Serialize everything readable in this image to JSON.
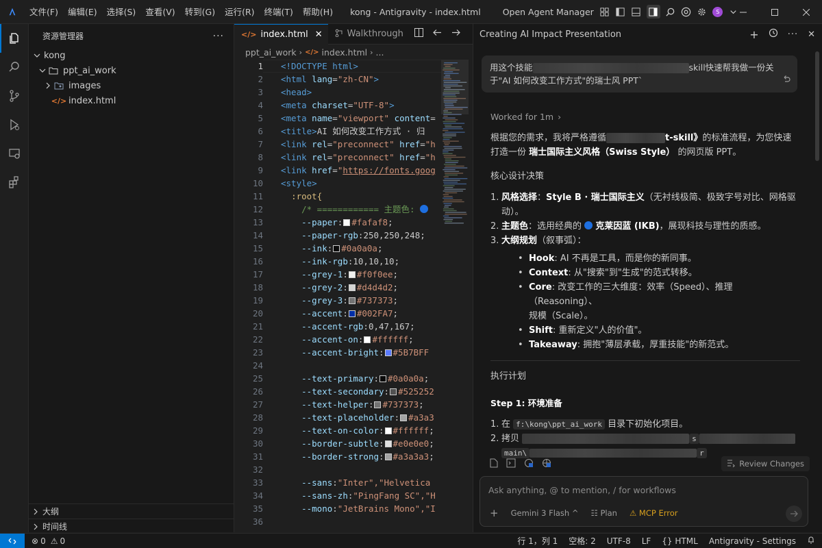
{
  "titlebar": {
    "menus": [
      "文件(F)",
      "编辑(E)",
      "选择(S)",
      "查看(V)",
      "转到(G)",
      "运行(R)",
      "终端(T)",
      "帮助(H)"
    ],
    "window_title": "kong - Antigravity - index.html",
    "agent_manager": "Open Agent Manager",
    "avatar_letter": "S"
  },
  "sidebar": {
    "title": "资源管理器",
    "root": "kong",
    "folder": "ppt_ai_work",
    "subfolder": "images",
    "file": "index.html",
    "outline": "大纲",
    "timeline": "时间线"
  },
  "editor": {
    "tab_active": "index.html",
    "tab_inactive": "Walkthrough",
    "breadcrumb_folder": "ppt_ai_work",
    "breadcrumb_file": "index.html",
    "breadcrumb_more": "..."
  },
  "code": {
    "l1": "<!DOCTYPE html>",
    "l2a": "<html",
    "l2b": " lang",
    "l2c": "=",
    "l2d": "\"zh-CN\"",
    "l2e": ">",
    "l3": "<head>",
    "l4a": "<meta",
    "l4b": " charset",
    "l4d": "\"UTF-8\"",
    "l4e": ">",
    "l5a": "<meta",
    "l5b": " name",
    "l5d": "\"viewport\"",
    "l5f": " content",
    "l6a": "<title>",
    "l6b": "AI 如何改变工作方式 · 归",
    "l7a": "<link",
    "l7b": " rel",
    "l7d": "\"preconnect\"",
    "l7f": " href",
    "l7g": "\"h",
    "l8a": "<link",
    "l8b": " rel",
    "l8d": "\"preconnect\"",
    "l8f": " href",
    "l8g": "\"h",
    "l9a": "<link",
    "l9b": " href",
    "l9d": "\"",
    "l9url": "https://fonts.goog",
    "l10": "<style>",
    "l11": ":root{",
    "l12": "/* ============ 主题色: ",
    "l13a": "--paper",
    "l13b": "#fafaf8",
    "l13c": ";",
    "l14a": "--paper-rgb",
    "l14b": "250,250,248",
    "l14c": ";",
    "l15a": "--ink",
    "l15b": "#0a0a0a",
    "l15c": ";",
    "l16a": "--ink-rgb",
    "l16b": "10,10,10",
    "l16c": ";",
    "l17a": "--grey-1",
    "l17b": "#f0f0ee",
    "l17c": ";",
    "l18a": "--grey-2",
    "l18b": "#d4d4d2",
    "l18c": ";",
    "l19a": "--grey-3",
    "l19b": "#737373",
    "l19c": ";",
    "l20a": "--accent",
    "l20b": "#002FA7",
    "l20c": ";",
    "l21a": "--accent-rgb",
    "l21b": "0,47,167",
    "l21c": ";",
    "l22a": "--accent-on",
    "l22b": "#ffffff",
    "l22c": ";",
    "l23a": "--accent-bright",
    "l23b": "#5B7BFF",
    "l25a": "--text-primary",
    "l25b": "#0a0a0a",
    "l25c": ";",
    "l26a": "--text-secondary",
    "l26b": "#525252",
    "l27a": "--text-helper",
    "l27b": "#737373",
    "l27c": ";",
    "l28a": "--text-placeholder",
    "l28b": "#a3a3",
    "l29a": "--text-on-color",
    "l29b": "#ffffff",
    "l29c": ";",
    "l30a": "--border-subtle",
    "l30b": "#e0e0e0",
    "l30c": ";",
    "l31a": "--border-strong",
    "l31b": "#a3a3a3",
    "l31c": ";",
    "l33a": "--sans",
    "l33b": "\"Inter\",\"Helvetica",
    "l34a": "--sans-zh",
    "l34b": "\"PingFang SC\",\"H",
    "l35a": "--mono",
    "l35b": "\"JetBrains Mono\",\"I"
  },
  "agent": {
    "title": "Creating AI Impact Presentation",
    "user_msg_a": "用这个技能",
    "user_msg_b": "skill快速帮我做一份关",
    "user_msg_c": "于\"AI 如何改变工作方式\"的瑞士风 PPT`",
    "worked": "Worked for 1m",
    "intro_a": "根据您的需求，我将严格遵循",
    "intro_b": "t-skill》",
    "intro_c": "的标准流程，为您快速",
    "intro_d": "打造一份",
    "intro_bold": "瑞士国际主义风格（Swiss Style）",
    "intro_e": "的网页版 PPT。",
    "core_title": "核心设计决策",
    "d1_label": "风格选择",
    "d1_bold": "Style B · 瑞士国际主义",
    "d1_rest": "（无衬线极简、极致字号对比、网格驱",
    "d1_rest2": "动）。",
    "d2_label": "主题色",
    "d2_text": "：选用经典的",
    "d2_bold": "克莱因蓝 (IKB)",
    "d2_rest": "，展现科技与理性的质感。",
    "d3_label": "大纲规划",
    "d3_rest": "（叙事弧）：",
    "b1_label": "Hook",
    "b1_text": ": AI 不再是工具，而是你的新同事。",
    "b2_label": "Context",
    "b2_text": ": 从\"搜索\"到\"生成\"的范式转移。",
    "b3_label": "Core",
    "b3_text": ": 改变工作的三大维度：效率（Speed）、推理（Reasoning）、",
    "b3_text2": "规模（Scale）。",
    "b4_label": "Shift",
    "b4_text": ": 重新定义\"人的价值\"。",
    "b5_label": "Takeaway",
    "b5_text": ": 拥抱\"薄层承载，厚重技能\"的新范式。",
    "plan_title": "执行计划",
    "step1": "Step 1: 环境准备",
    "s1_a": "在",
    "s1_code": "f:\\kong\\ppt_ai_work",
    "s1_b": "目录下初始化项目。",
    "s2_a": "拷贝",
    "s2_b": "s",
    "s2_c": "main\\",
    "s2_d": "r",
    "review": "Review Changes",
    "placeholder": "Ask anything, @ to mention, / for workflows",
    "model": "Gemini 3 Flash",
    "plan": "Plan",
    "mcp": "MCP Error"
  },
  "status": {
    "errors": "0",
    "warnings": "0",
    "position": "行 1，列 1",
    "spaces": "空格: 2",
    "encoding": "UTF-8",
    "eol": "LF",
    "language": "HTML",
    "settings": "Antigravity - Settings"
  },
  "colors": {
    "accent_blue": "#0078d4",
    "ikb": "#002FA7",
    "mcp_error": "#d8a01e"
  }
}
